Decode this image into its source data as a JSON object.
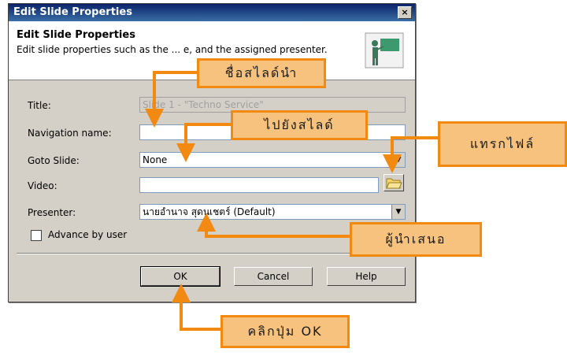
{
  "dialog": {
    "title": "Edit Slide Properties",
    "close_glyph": "×",
    "header_title": "Edit Slide Properties",
    "header_desc": "Edit slide properties such as the ... e, and the assigned presenter.",
    "header_icon": "presenter-board-icon"
  },
  "form": {
    "title_label": "Title:",
    "title_value": "Slide 1 - \"Techno Service\"",
    "nav_label": "Navigation name:",
    "nav_value": "",
    "goto_label": "Goto Slide:",
    "goto_value": "None",
    "video_label": "Video:",
    "video_value": "",
    "presenter_label": "Presenter:",
    "presenter_value": "นายอำนาจ สุดนเชตร์ (Default)",
    "advance_label": "Advance by user"
  },
  "buttons": {
    "ok": "OK",
    "cancel": "Cancel",
    "help": "Help"
  },
  "callouts": {
    "slide_name": "ชื่อสไลด์นำ",
    "goto_slide": "ไปยังสไลด์",
    "insert_file": "แทรกไฟล์",
    "presenter": "ผู้นำเสนอ",
    "click_ok": "คลิกปุ่ม OK"
  },
  "colors": {
    "callout_fill": "#f7c27d",
    "callout_border": "#f28a12",
    "titlebar": "#0a246a"
  }
}
